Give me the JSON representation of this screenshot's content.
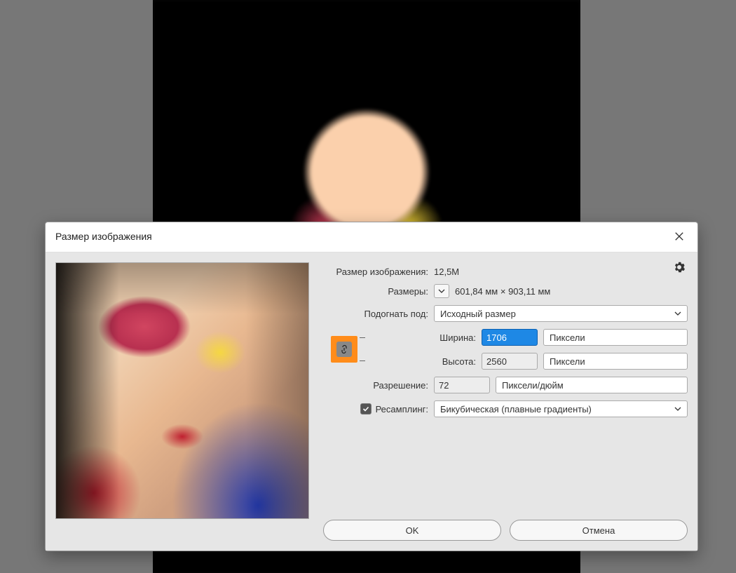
{
  "dialog": {
    "title": "Размер изображения",
    "size_label": "Размер изображения:",
    "size_value": "12,5M",
    "dimensions_label": "Размеры:",
    "dimensions_value": "601,84 мм  ×  903,11 мм",
    "fit_label": "Подогнать под:",
    "fit_value": "Исходный размер",
    "width_label": "Ширина:",
    "width_value": "1706",
    "width_unit": "Пиксели",
    "height_label": "Высота:",
    "height_value": "2560",
    "height_unit": "Пиксели",
    "resolution_label": "Разрешение:",
    "resolution_value": "72",
    "resolution_unit": "Пиксели/дюйм",
    "resample_label": "Ресамплинг:",
    "resample_value": "Бикубическая (плавные градиенты)",
    "ok": "OK",
    "cancel": "Отмена"
  }
}
